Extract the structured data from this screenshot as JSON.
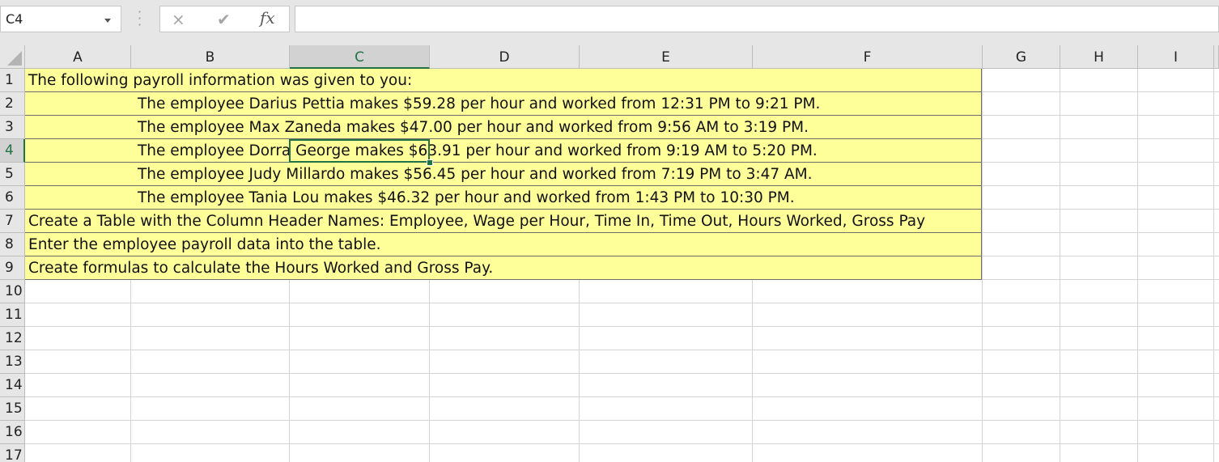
{
  "formula_bar": {
    "name_box": "C4",
    "cancel_glyph": "×",
    "enter_glyph": "✔",
    "fx_label": "fx",
    "formula_value": ""
  },
  "grid": {
    "columns": [
      "A",
      "B",
      "C",
      "D",
      "E",
      "F",
      "G",
      "H",
      "I"
    ],
    "rows": [
      "1",
      "2",
      "3",
      "4",
      "5",
      "6",
      "7",
      "8",
      "9",
      "10",
      "11",
      "12",
      "13",
      "14",
      "15",
      "16",
      "17"
    ],
    "active_column": "C",
    "active_row": "4",
    "fill_color": "#ffff99",
    "accent_color": "#217346"
  },
  "cells": {
    "r1": "The following payroll information was given to you:",
    "r2": "The employee Darius Pettia makes $59.28 per hour and worked from 12:31 PM to 9:21 PM.",
    "r3": "The employee Max Zaneda makes $47.00 per hour and worked from 9:56 AM to 3:19 PM.",
    "r4": "The employee Dorra George makes $63.91 per hour and worked from 9:19 AM to 5:20 PM.",
    "r5": "The employee Judy Millardo makes $56.45 per hour and worked from 7:19 PM to 3:47 AM.",
    "r6": "The employee Tania Lou makes $46.32 per hour and worked from 1:43 PM to 10:30 PM.",
    "r7": "Create a Table with the Column Header Names: Employee, Wage per Hour, Time In, Time Out, Hours Worked, Gross Pay",
    "r8": "Enter the employee payroll data into the table.",
    "r9": "Create formulas to calculate the Hours Worked and Gross Pay."
  }
}
